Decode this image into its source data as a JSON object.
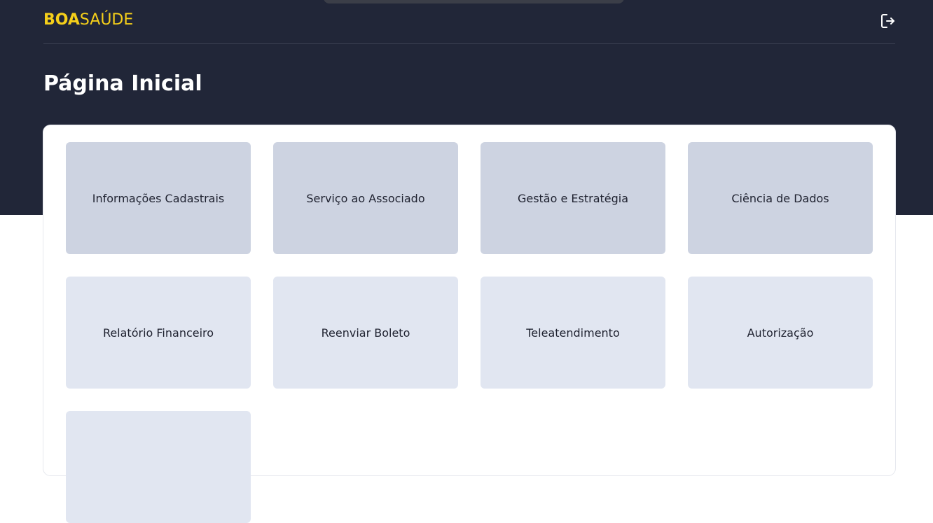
{
  "header": {
    "logo_bold": "BOA",
    "logo_regular": "SAÚDE"
  },
  "page": {
    "title": "Página Inicial"
  },
  "cards": [
    {
      "label": "Informações Cadastrais"
    },
    {
      "label": "Serviço ao Associado"
    },
    {
      "label": "Gestão e Estratégia"
    },
    {
      "label": "Ciência de Dados"
    },
    {
      "label": "Relatório Financeiro"
    },
    {
      "label": "Reenviar Boleto"
    },
    {
      "label": "Teleatendimento"
    },
    {
      "label": "Autorização"
    },
    {
      "label": ""
    }
  ],
  "icons": {
    "logout": "logout-icon"
  },
  "colors": {
    "header_bg": "#212638",
    "brand_yellow": "#f5cf1a",
    "card_top_row": "#cdd3e1",
    "card_other_rows": "#e1e6f1"
  }
}
